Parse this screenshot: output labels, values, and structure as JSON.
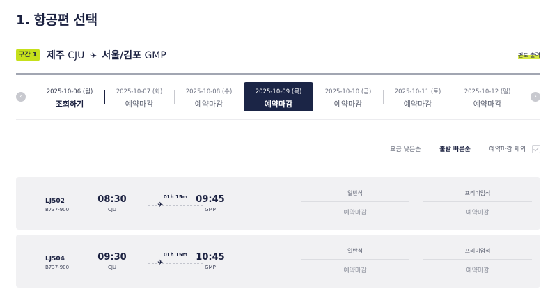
{
  "page_title": "1. 항공편 선택",
  "segment": {
    "badge": "구간 1",
    "origin_city": "제주",
    "origin_code": "CJU",
    "dest_city": "서울/김포",
    "dest_code": "GMP",
    "plane_icon": "plane-icon",
    "oneway_link": "편도 출력"
  },
  "date_nav": {
    "prev_icon": "chevron-left-icon",
    "next_icon": "chevron-right-icon",
    "dates": [
      {
        "date": "2025-10-06 (월)",
        "status": "조회하기"
      },
      {
        "date": "2025-10-07 (화)",
        "status": "예약마감"
      },
      {
        "date": "2025-10-08 (수)",
        "status": "예약마감"
      },
      {
        "date": "2025-10-09 (목)",
        "status": "예약마감"
      },
      {
        "date": "2025-10-10 (금)",
        "status": "예약마감"
      },
      {
        "date": "2025-10-11 (토)",
        "status": "예약마감"
      },
      {
        "date": "2025-10-12 (일)",
        "status": "예약마감"
      }
    ],
    "selected_index": 3
  },
  "sort": {
    "options": [
      "요금 낮은순",
      "출발 빠른순"
    ],
    "selected": "출발 빠른순",
    "exclude_closed_label": "예약마감 제외",
    "exclude_closed_checked": false
  },
  "flights": [
    {
      "flight_no": "LJ502",
      "aircraft": "B737-900",
      "dep_time": "08:30",
      "dep_code": "CJU",
      "duration": "01h 15m",
      "arr_time": "09:45",
      "arr_code": "GMP",
      "fares": [
        {
          "class": "일반석",
          "status": "예약마감"
        },
        {
          "class": "프리미엄석",
          "status": "예약마감"
        }
      ]
    },
    {
      "flight_no": "LJ504",
      "aircraft": "B737-900",
      "dep_time": "09:30",
      "dep_code": "CJU",
      "duration": "01h 15m",
      "arr_time": "10:45",
      "arr_code": "GMP",
      "fares": [
        {
          "class": "일반석",
          "status": "예약마감"
        },
        {
          "class": "프리미엄석",
          "status": "예약마감"
        }
      ]
    }
  ],
  "colors": {
    "primary_navy": "#1b2546",
    "accent_lime": "#c6e01b",
    "card_bg": "#f1f1f3"
  }
}
